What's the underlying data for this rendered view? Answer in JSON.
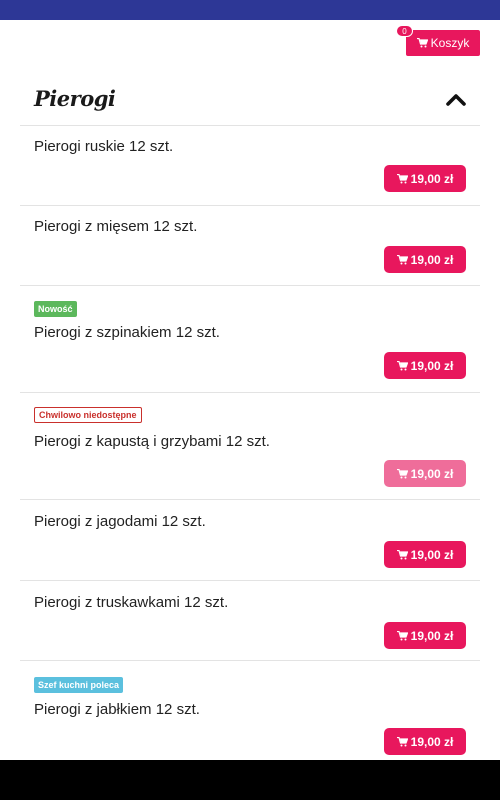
{
  "cart": {
    "label": "Koszyk",
    "count": "0"
  },
  "section": {
    "title": "Pierogi"
  },
  "products": [
    {
      "name": "Pierogi ruskie 12 szt.",
      "price": "19,00 zł"
    },
    {
      "name": "Pierogi z mięsem 12 szt.",
      "price": "19,00 zł"
    },
    {
      "name": "Pierogi z szpinakiem 12 szt.",
      "price": "19,00 zł",
      "badge": "Nowość"
    },
    {
      "name": "Pierogi z kapustą i grzybami 12 szt.",
      "price": "19,00 zł",
      "badge": "Chwilowo niedostępne"
    },
    {
      "name": "Pierogi z jagodami 12 szt.",
      "price": "19,00 zł"
    },
    {
      "name": "Pierogi z truskawkami 12 szt.",
      "price": "19,00 zł"
    },
    {
      "name": "Pierogi z jabłkiem 12 szt.",
      "price": "19,00 zł",
      "badge": "Szef kuchni poleca"
    }
  ],
  "colors": {
    "accent": "#e8175d",
    "status_bar": "#2d3796",
    "badge_new": "#5cb85c",
    "badge_unavailable": "#c9302c",
    "badge_chef": "#5bc0de"
  },
  "icons": {
    "cart": "cart-icon",
    "collapse": "chevron-up-icon"
  }
}
